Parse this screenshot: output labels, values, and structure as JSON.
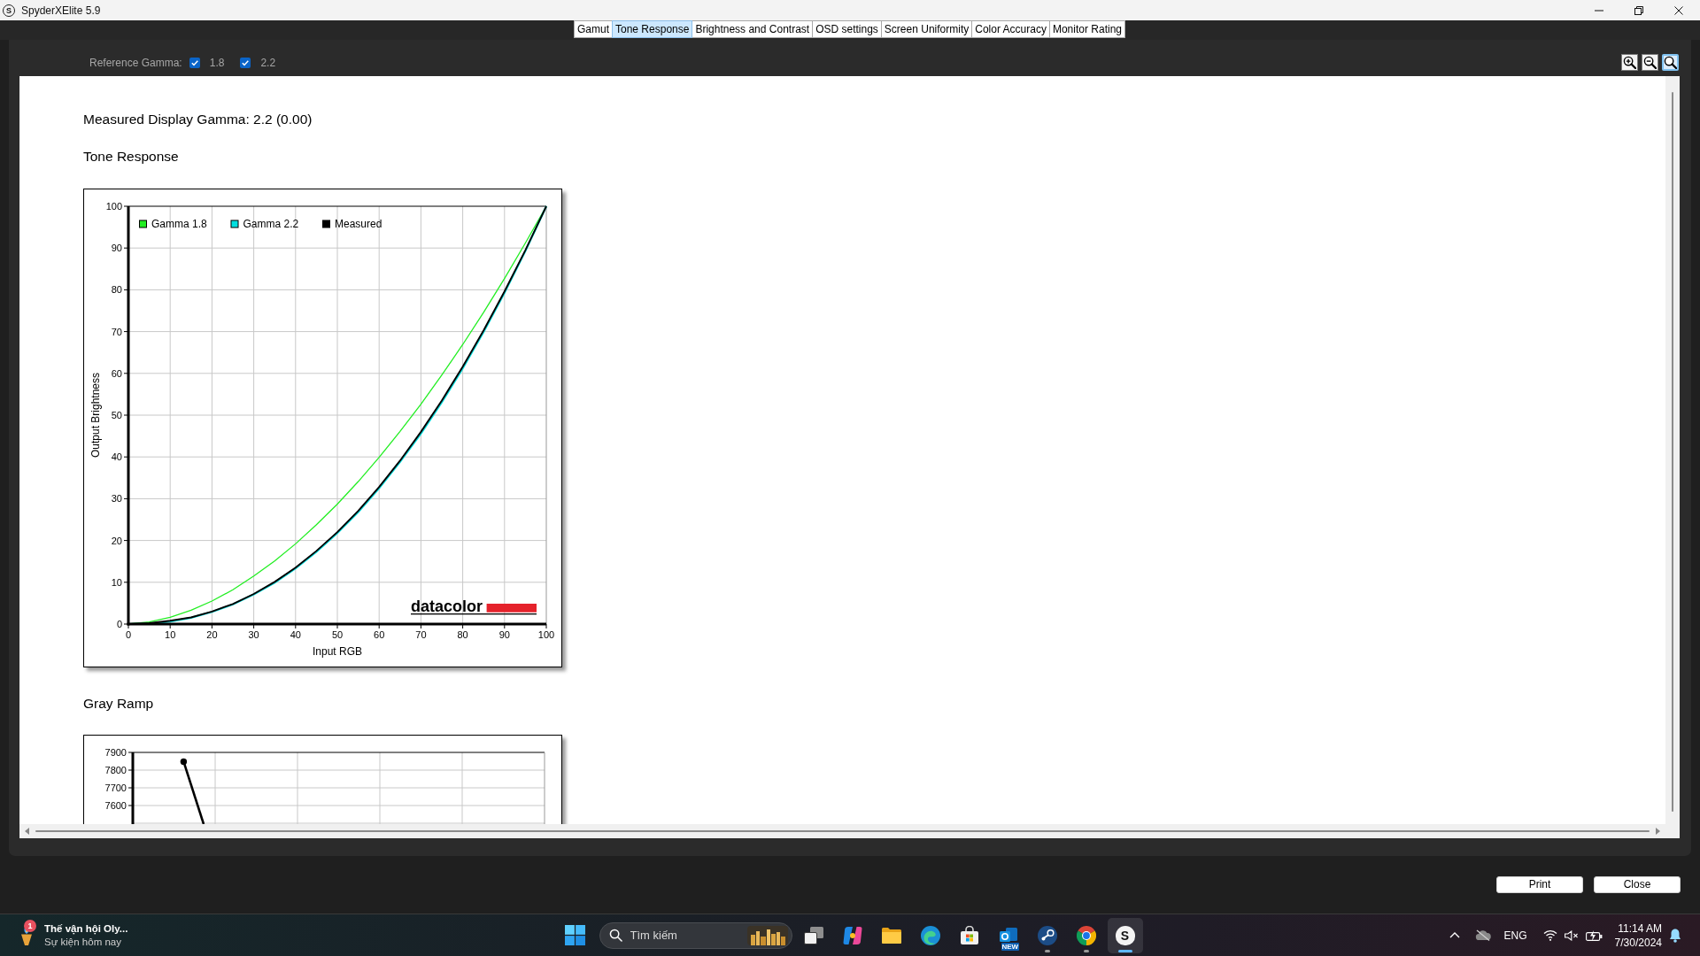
{
  "window": {
    "title": "SpyderXElite 5.9",
    "logo_letter": "S"
  },
  "tabs": [
    {
      "label": "Gamut",
      "selected": false
    },
    {
      "label": "Tone Response",
      "selected": true
    },
    {
      "label": "Brightness and Contrast",
      "selected": false
    },
    {
      "label": "OSD settings",
      "selected": false
    },
    {
      "label": "Screen Uniformity",
      "selected": false
    },
    {
      "label": "Color Accuracy",
      "selected": false
    },
    {
      "label": "Monitor Rating",
      "selected": false
    }
  ],
  "toolbar": {
    "reference_gamma": {
      "label": "Reference Gamma:",
      "options": [
        {
          "label": "1.8",
          "checked": true
        },
        {
          "label": "2.2",
          "checked": true
        }
      ]
    },
    "zoom_tools": [
      {
        "kind": "plus",
        "selected": false
      },
      {
        "kind": "minus",
        "selected": false
      },
      {
        "kind": "plain",
        "selected": true
      }
    ]
  },
  "report": {
    "measured_gamma": "Measured Display Gamma: 2.2 (0.00)",
    "tone_response": {
      "heading": "Tone Response",
      "logo": "datacolor",
      "chart_data": {
        "type": "line",
        "xlabel": "Input RGB",
        "ylabel": "Output Brightness",
        "x": [
          0,
          5,
          10,
          15,
          20,
          25,
          30,
          35,
          40,
          45,
          50,
          55,
          60,
          65,
          70,
          75,
          80,
          85,
          90,
          95,
          100
        ],
        "series": [
          {
            "name": "Gamma 1.8",
            "color": "#22ee22",
            "values": [
              0,
              0.5,
              1.6,
              3.3,
              5.5,
              8.2,
              11.5,
              15.1,
              19.2,
              23.8,
              28.7,
              34.1,
              39.9,
              46.1,
              52.6,
              59.6,
              66.9,
              74.6,
              82.7,
              91.2,
              100
            ]
          },
          {
            "name": "Gamma 2.2",
            "color": "#00e0e0",
            "values": [
              0,
              0.1,
              0.6,
              1.5,
              2.9,
              4.7,
              7.1,
              9.9,
              13.3,
              17.3,
              21.8,
              26.8,
              32.5,
              38.8,
              45.6,
              53.1,
              61.2,
              69.9,
              79.3,
              89.3,
              100
            ]
          },
          {
            "name": "Measured",
            "color": "#000000",
            "values": [
              0,
              0.2,
              0.8,
              1.6,
              3,
              4.8,
              7.2,
              10.1,
              13.5,
              17.5,
              22,
              27.1,
              32.8,
              39.1,
              46,
              53.5,
              61.6,
              70.3,
              79.6,
              89.5,
              100
            ]
          }
        ],
        "xlim": [
          0,
          100
        ],
        "ylim": [
          0,
          100
        ],
        "xticks": [
          0,
          10,
          20,
          30,
          40,
          50,
          60,
          70,
          80,
          90,
          100
        ],
        "yticks": [
          0,
          10,
          20,
          30,
          40,
          50,
          60,
          70,
          80,
          90,
          100
        ],
        "grid": true,
        "legend": "upper left"
      }
    },
    "gray_ramp": {
      "heading": "Gray Ramp",
      "y_tick_labels": [
        "7900",
        "7800",
        "7700",
        "7600"
      ]
    }
  },
  "buttons": [
    "Print",
    "Close"
  ],
  "taskbar": {
    "widget": {
      "title": "Thế vận hội Oly...",
      "subtitle": "Sự kiện hôm nay",
      "badge": "1"
    },
    "search": {
      "placeholder": "Tìm kiếm"
    },
    "apps": [
      {
        "kind": "taskview",
        "running": false,
        "selected": false
      },
      {
        "kind": "swirl",
        "running": false,
        "selected": false
      },
      {
        "kind": "folder",
        "running": false,
        "selected": false
      },
      {
        "kind": "wave",
        "running": false,
        "selected": false
      },
      {
        "kind": "store",
        "running": false,
        "selected": false
      },
      {
        "kind": "mail",
        "badge": "NEW",
        "running": false,
        "selected": false
      },
      {
        "kind": "piston",
        "running": true,
        "selected": false
      },
      {
        "kind": "ring",
        "running": true,
        "selected": false
      },
      {
        "kind": "letter",
        "letter": "S",
        "running": true,
        "selected": true
      }
    ],
    "tray": {
      "language": "ENG",
      "muted": true,
      "charging": true,
      "time": "11:14 AM",
      "date": "7/30/2024"
    }
  }
}
